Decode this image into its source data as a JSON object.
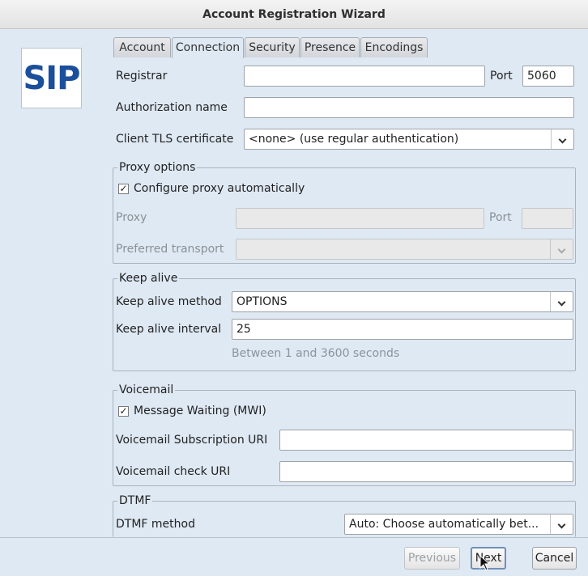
{
  "window": {
    "title": "Account Registration Wizard"
  },
  "logo": {
    "text": "SIP"
  },
  "tabs": [
    {
      "label": "Account",
      "active": false
    },
    {
      "label": "Connection",
      "active": true
    },
    {
      "label": "Security",
      "active": false
    },
    {
      "label": "Presence",
      "active": false
    },
    {
      "label": "Encodings",
      "active": false
    }
  ],
  "connection": {
    "registrar_label": "Registrar",
    "registrar_value": "",
    "port_label": "Port",
    "port_value": "5060",
    "auth_name_label": "Authorization name",
    "auth_name_value": "",
    "tls_label": "Client TLS certificate",
    "tls_value": "<none> (use regular authentication)"
  },
  "proxy": {
    "legend": "Proxy options",
    "auto_label": "Configure proxy automatically",
    "auto_checked": true,
    "proxy_label": "Proxy",
    "proxy_value": "",
    "port_label": "Port",
    "port_value": "",
    "transport_label": "Preferred transport",
    "transport_value": ""
  },
  "keepalive": {
    "legend": "Keep alive",
    "method_label": "Keep alive method",
    "method_value": "OPTIONS",
    "interval_label": "Keep alive interval",
    "interval_value": "25",
    "hint": "Between 1 and 3600 seconds"
  },
  "voicemail": {
    "legend": "Voicemail",
    "mwi_label": "Message Waiting (MWI)",
    "mwi_checked": true,
    "subscription_label": "Voicemail Subscription URI",
    "subscription_value": "",
    "check_label": "Voicemail check URI",
    "check_value": ""
  },
  "dtmf": {
    "legend": "DTMF",
    "method_label": "DTMF method",
    "method_value": "Auto: Choose automatically bet..."
  },
  "footer": {
    "previous_label": "Previous",
    "next_label": "Next",
    "cancel_label": "Cancel"
  },
  "glyphs": {
    "check": "✓"
  }
}
